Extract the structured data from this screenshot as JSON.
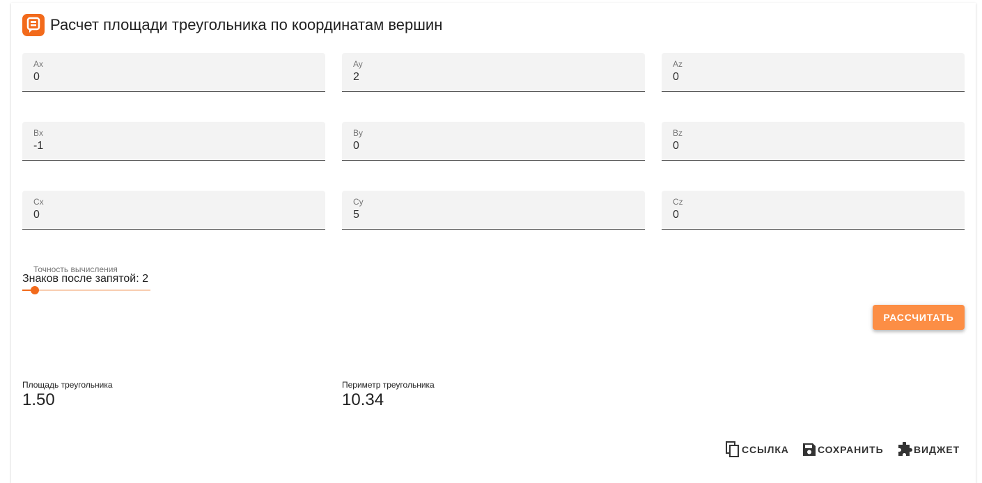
{
  "header": {
    "title": "Расчет площади треугольника по координатам вершин",
    "logo_icon": "calculator-logo-icon",
    "accent_color": "#f26a1b"
  },
  "fields": {
    "ax": {
      "label": "Ax",
      "value": "0"
    },
    "ay": {
      "label": "Ay",
      "value": "2"
    },
    "az": {
      "label": "Az",
      "value": "0"
    },
    "bx": {
      "label": "Bx",
      "value": "-1"
    },
    "by": {
      "label": "By",
      "value": "0"
    },
    "bz": {
      "label": "Bz",
      "value": "0"
    },
    "cx": {
      "label": "Cx",
      "value": "0"
    },
    "cy": {
      "label": "Cy",
      "value": "5"
    },
    "cz": {
      "label": "Cz",
      "value": "0"
    }
  },
  "precision": {
    "label": "Точность вычисления",
    "text": "Знаков после запятой: 2",
    "level": 0.1
  },
  "buttons": {
    "calculate": "РАССЧИТАТЬ",
    "calculate_color": "#fc8e45"
  },
  "results": {
    "area_label": "Площадь треугольника",
    "area_value": "1.50",
    "perimeter_label": "Периметр треугольника",
    "perimeter_value": "10.34"
  },
  "actions": {
    "link": "ССЫЛКА",
    "link_icon": "copy-icon",
    "save": "СОХРАНИТЬ",
    "save_icon": "floppy-disk-icon",
    "widget": "ВИДЖЕТ",
    "widget_icon": "puzzle-piece-icon"
  }
}
